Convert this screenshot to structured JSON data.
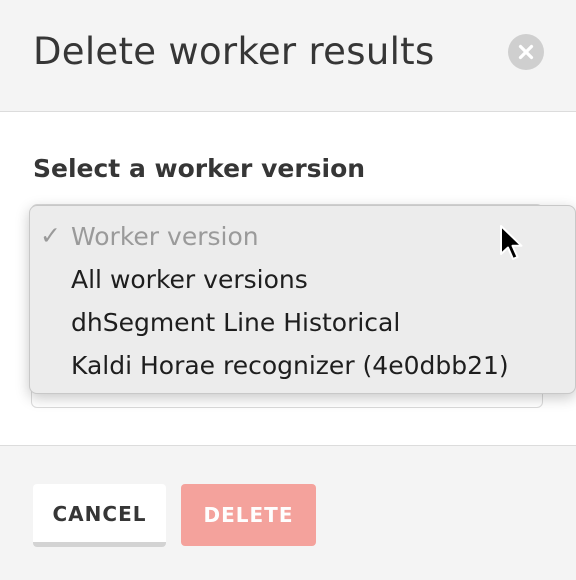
{
  "modal": {
    "title": "Delete worker results"
  },
  "form": {
    "label": "Select a worker version",
    "select": {
      "selected": "Worker version",
      "check_mark": "✓",
      "options": [
        {
          "label": "Worker version",
          "placeholder": true,
          "checked": true
        },
        {
          "label": "All worker versions"
        },
        {
          "label": "dhSegment Line Historical"
        },
        {
          "label": "Kaldi Horae recognizer (4e0dbb21)"
        }
      ]
    }
  },
  "footer": {
    "cancel_label": "CANCEL",
    "delete_label": "DELETE",
    "delete_enabled": false
  },
  "icons": {
    "close": "close-icon",
    "cursor": "mouse-pointer-icon",
    "check": "checkmark-icon"
  },
  "colors": {
    "delete_button": "#f59e98",
    "close_button": "#cfcfcf",
    "title_text": "#363636"
  }
}
